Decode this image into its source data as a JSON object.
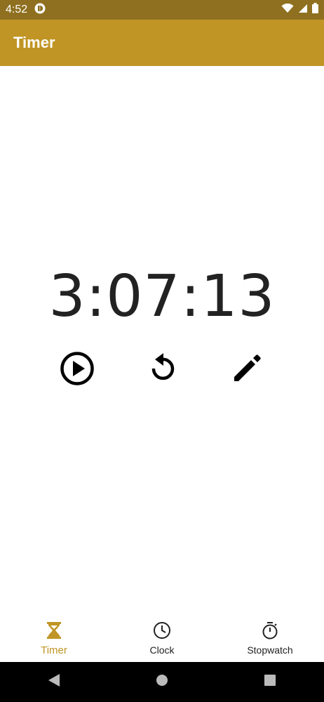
{
  "status_bar": {
    "time": "4:52"
  },
  "app_bar": {
    "title": "Timer"
  },
  "timer": {
    "display": "3:07:13"
  },
  "controls": {
    "play_icon": "play-circle-icon",
    "reset_icon": "reset-icon",
    "edit_icon": "pencil-icon"
  },
  "bottom_nav": {
    "items": [
      {
        "label": "Timer",
        "icon": "hourglass-icon",
        "active": true
      },
      {
        "label": "Clock",
        "icon": "clock-icon",
        "active": false
      },
      {
        "label": "Stopwatch",
        "icon": "stopwatch-icon",
        "active": false
      }
    ]
  },
  "colors": {
    "status_bar": "#8f7020",
    "app_bar": "#c09525",
    "accent": "#c09525"
  }
}
